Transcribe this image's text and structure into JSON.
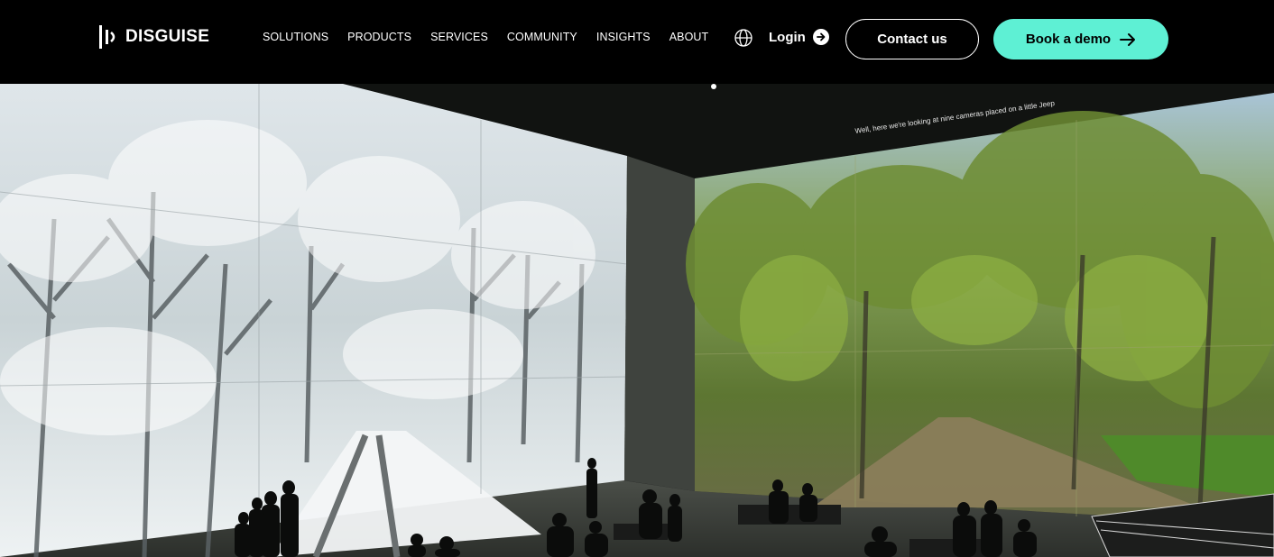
{
  "brand": {
    "name": "DISGUISE"
  },
  "nav": {
    "items": [
      "SOLUTIONS",
      "PRODUCTS",
      "SERVICES",
      "COMMUNITY",
      "INSIGHTS",
      "ABOUT"
    ]
  },
  "header": {
    "login_label": "Login",
    "contact_label": "Contact us",
    "demo_label": "Book a demo"
  },
  "hero": {
    "subtitle": "Well, here we're looking at nine cameras placed on a little Jeep"
  },
  "colors": {
    "accent": "#5ef0d4",
    "header_bg": "#000000"
  },
  "icons": {
    "language": "globe-icon",
    "login": "arrow-circle-right-icon",
    "demo": "arrow-right-icon"
  }
}
